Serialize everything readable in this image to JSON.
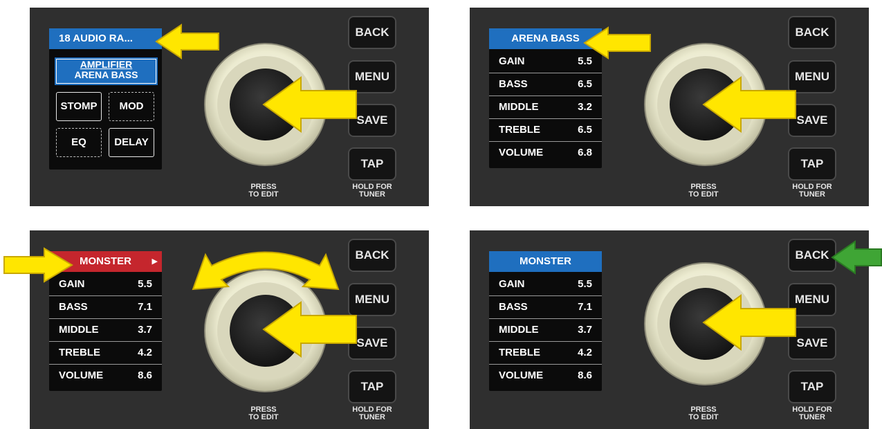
{
  "colors": {
    "panel": "#2f2f2f",
    "screen": "#0b0b0b",
    "title_blue": "#1f6fbf",
    "title_red": "#c5262d",
    "arrow_yellow": "#ffe600",
    "arrow_green": "#3fa535",
    "knob_ring": "#ecebd0",
    "knob_center": "#222222"
  },
  "buttons": {
    "back": "BACK",
    "menu": "MENU",
    "save": "SAVE",
    "tap": "TAP"
  },
  "captions": {
    "press_line1": "PRESS",
    "press_line2": "TO EDIT",
    "hold_line1": "HOLD FOR",
    "hold_line2": "TUNER"
  },
  "panel1": {
    "preset_title": "18 AUDIO RA...",
    "amp_label_line1": "AMPLIFIER",
    "amp_label_line2": "ARENA BASS",
    "effects": [
      "STOMP",
      "MOD",
      "EQ",
      "DELAY"
    ],
    "arrows": [
      "yellow-arrow-to-title",
      "yellow-arrow-to-knob"
    ]
  },
  "panel2": {
    "title": "ARENA BASS",
    "params": [
      {
        "name": "GAIN",
        "value": "5.5"
      },
      {
        "name": "BASS",
        "value": "6.5"
      },
      {
        "name": "MIDDLE",
        "value": "3.2"
      },
      {
        "name": "TREBLE",
        "value": "6.5"
      },
      {
        "name": "VOLUME",
        "value": "6.8"
      }
    ],
    "arrows": [
      "yellow-arrow-to-title",
      "yellow-arrow-to-knob"
    ]
  },
  "panel3": {
    "title": "MONSTER",
    "title_indicator": "▶",
    "params": [
      {
        "name": "GAIN",
        "value": "5.5"
      },
      {
        "name": "BASS",
        "value": "7.1"
      },
      {
        "name": "MIDDLE",
        "value": "3.7"
      },
      {
        "name": "TREBLE",
        "value": "4.2"
      },
      {
        "name": "VOLUME",
        "value": "8.6"
      }
    ],
    "arrows": [
      "yellow-arrow-to-title",
      "yellow-rotate-arrow",
      "yellow-arrow-to-knob"
    ]
  },
  "panel4": {
    "title": "MONSTER",
    "params": [
      {
        "name": "GAIN",
        "value": "5.5"
      },
      {
        "name": "BASS",
        "value": "7.1"
      },
      {
        "name": "MIDDLE",
        "value": "3.7"
      },
      {
        "name": "TREBLE",
        "value": "4.2"
      },
      {
        "name": "VOLUME",
        "value": "8.6"
      }
    ],
    "arrows": [
      "yellow-arrow-to-knob",
      "green-arrow-to-back-button"
    ]
  }
}
